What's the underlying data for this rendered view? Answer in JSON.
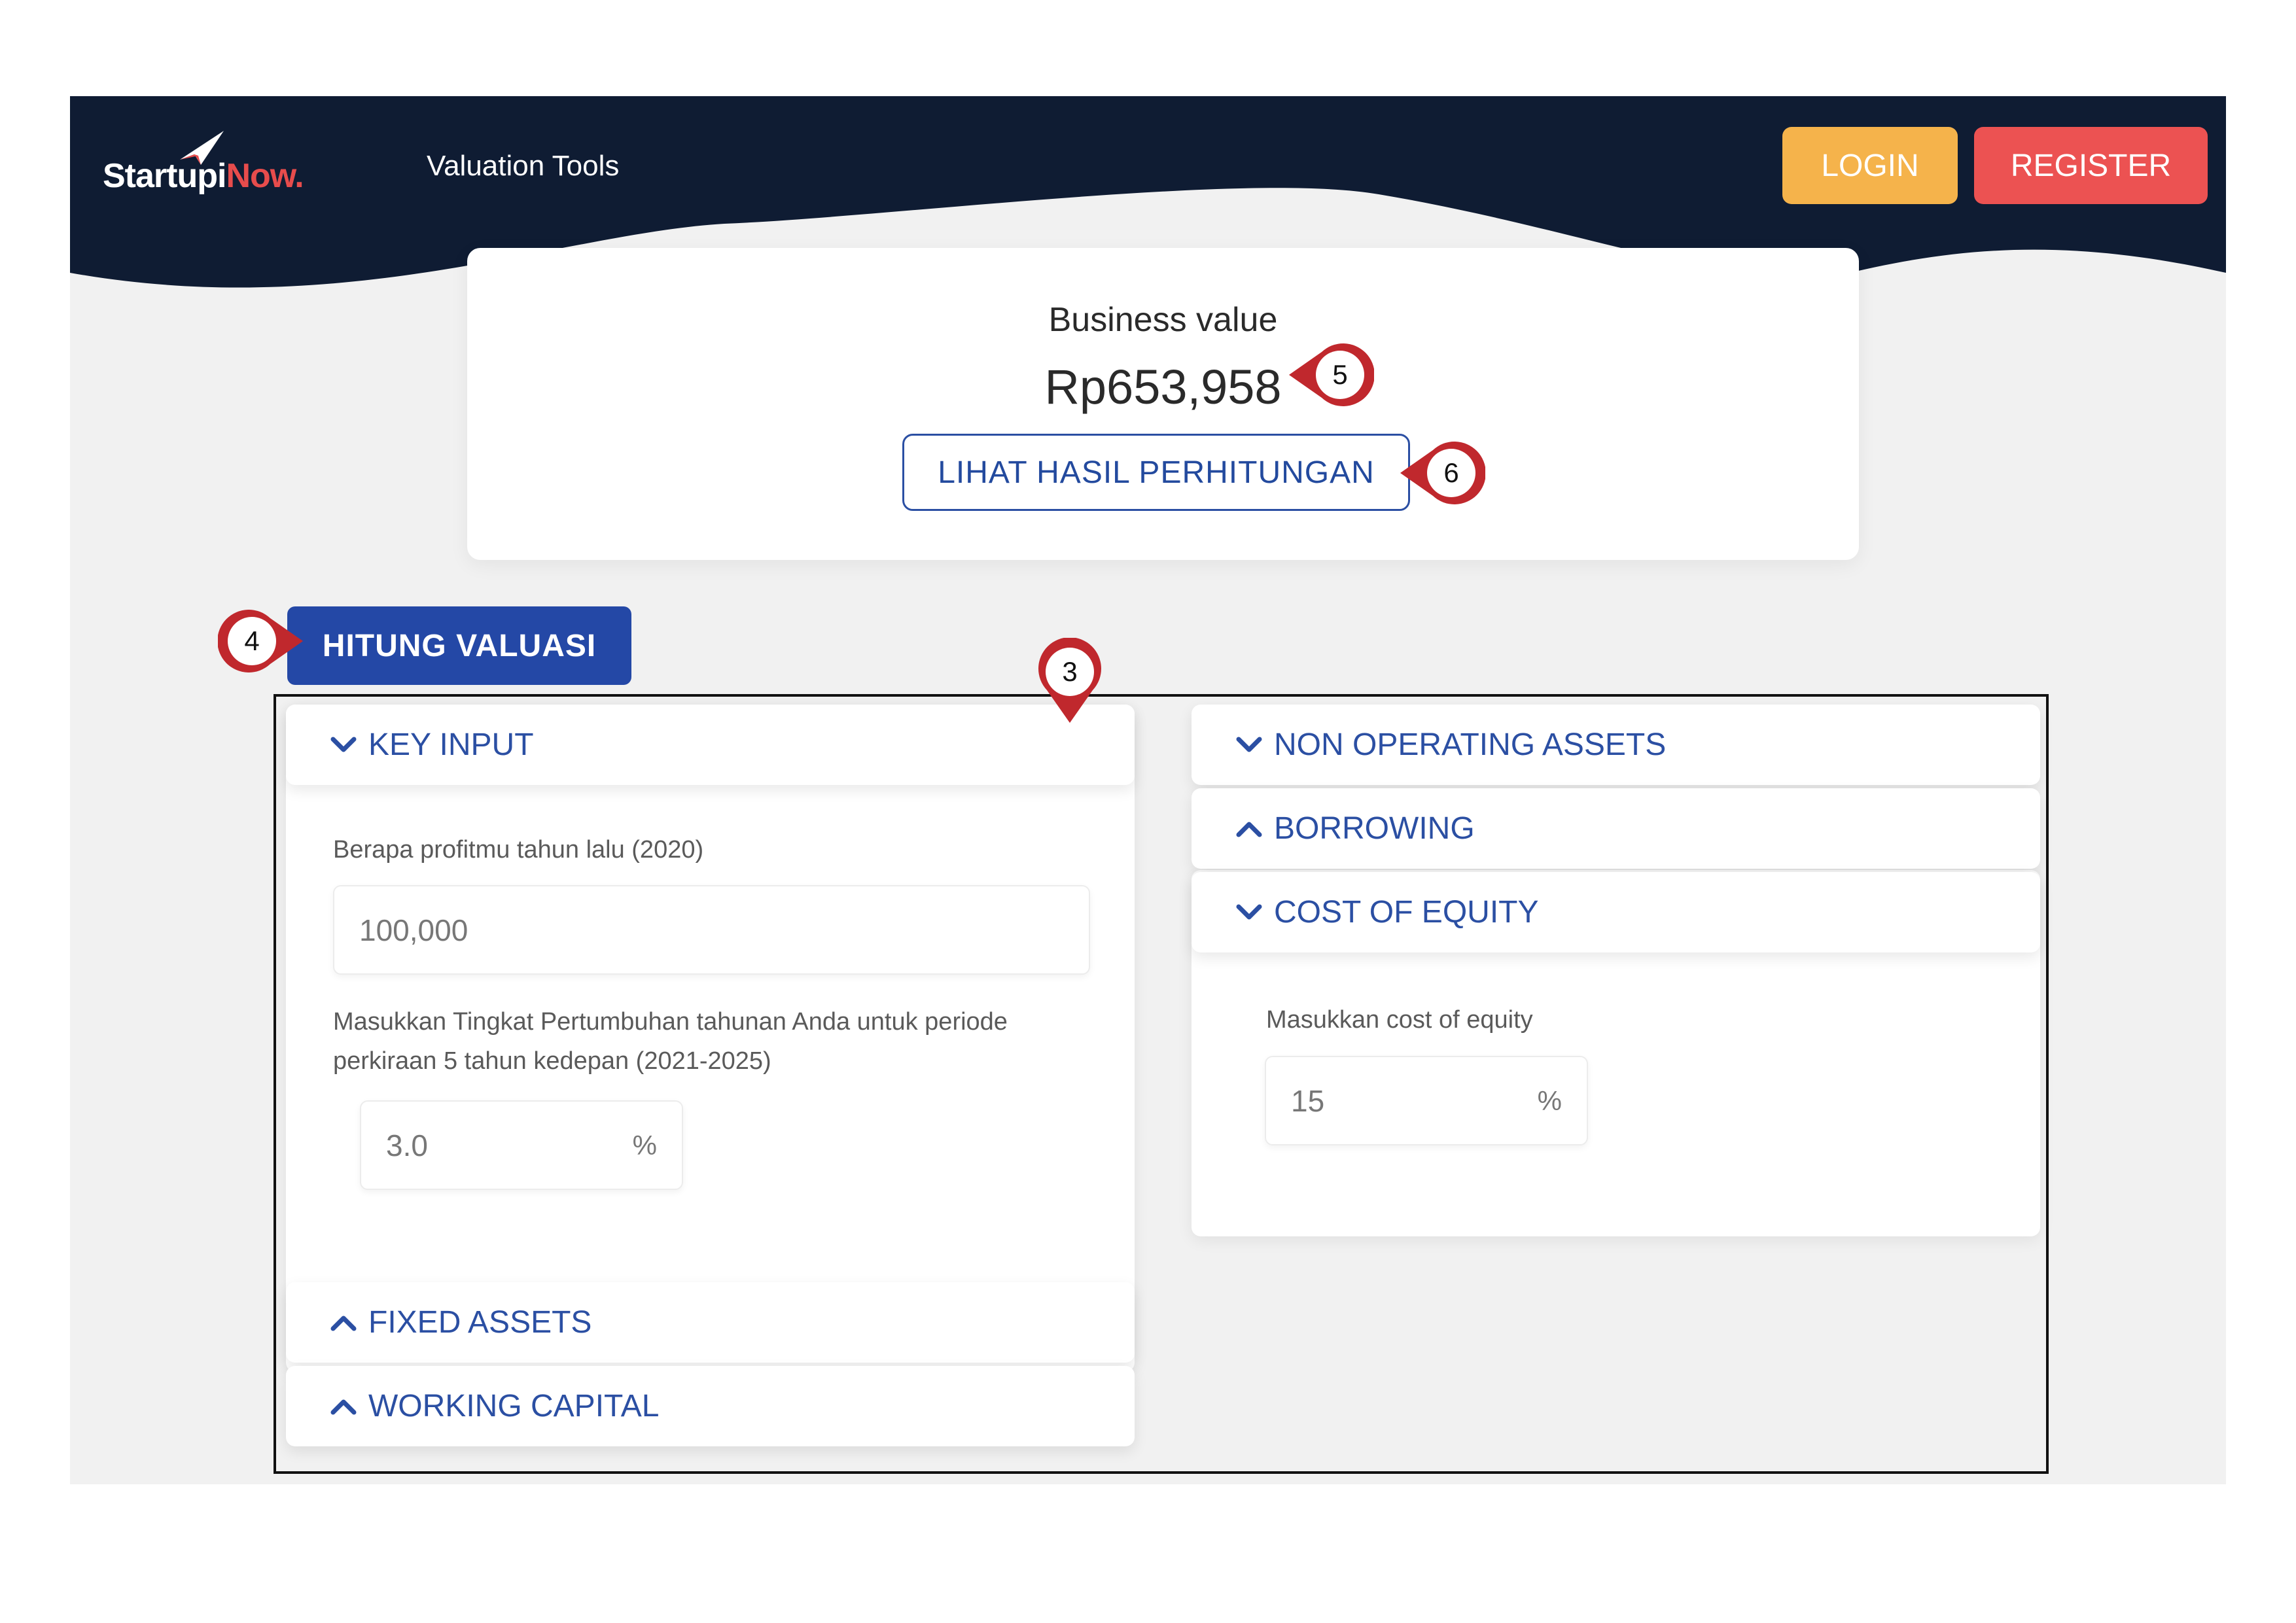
{
  "brand": {
    "logo_main": "Startupi",
    "logo_accent": "Now."
  },
  "nav": {
    "valuation_tools": "Valuation Tools",
    "login": "LOGIN",
    "register": "REGISTER"
  },
  "summary": {
    "label": "Business value",
    "value": "Rp653,958",
    "result_button": "LIHAT HASIL PERHITUNGAN"
  },
  "calculate_button": "HITUNG VALUASI",
  "left_panel": {
    "key_input": {
      "title": "KEY INPUT",
      "profit_label": "Berapa profitmu tahun lalu (2020)",
      "profit_value": "100,000",
      "growth_label_line1": "Masukkan Tingkat Pertumbuhan tahunan Anda untuk periode",
      "growth_label_line2": "perkiraan 5 tahun kedepan (2021-2025)",
      "growth_value": "3.0",
      "growth_unit": "%"
    },
    "fixed_assets": "FIXED ASSETS",
    "working_capital": "WORKING CAPITAL"
  },
  "right_panel": {
    "non_operating_assets": "NON OPERATING ASSETS",
    "borrowing": "BORROWING",
    "cost_of_equity": {
      "title": "COST OF EQUITY",
      "label": "Masukkan cost of equity",
      "value": "15",
      "unit": "%"
    }
  },
  "annotations": {
    "m3": "3",
    "m4": "4",
    "m5": "5",
    "m6": "6"
  },
  "colors": {
    "nav_bg": "#0f1c33",
    "login": "#f5b34b",
    "register": "#ec5252",
    "primary": "#2448a6",
    "marker": "#c0282d"
  }
}
